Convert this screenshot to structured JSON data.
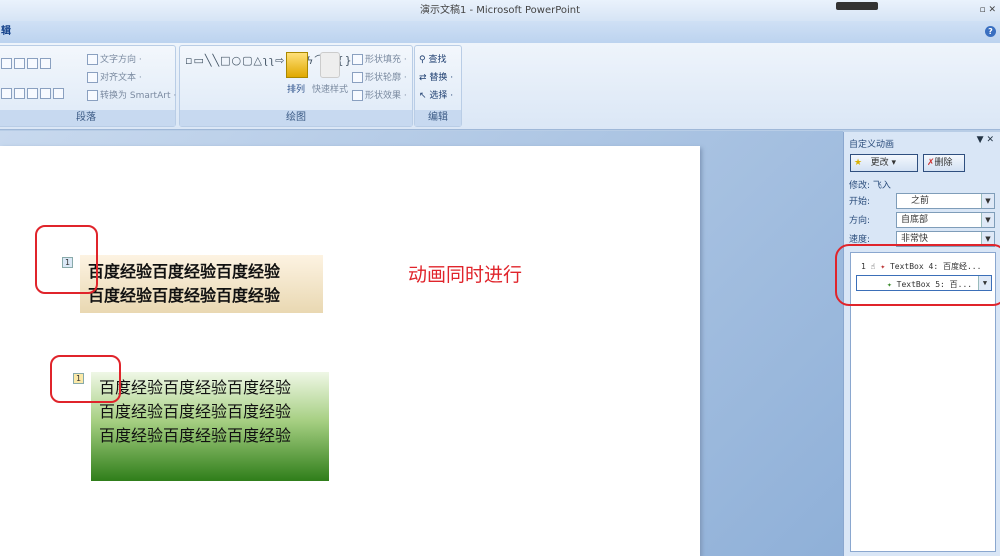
{
  "window": {
    "title": "演示文稿1 - Microsoft PowerPoint",
    "tab_fragment": "辑"
  },
  "ribbon": {
    "paragraph": {
      "label": "段落",
      "text_direction": "文字方向 ·",
      "align_text": "对齐文本 ·",
      "smartart": "转换为 SmartArt ·"
    },
    "drawing": {
      "label": "绘图",
      "arrange": "排列",
      "quick_styles": "快速样式",
      "shape_fill": "形状填充 ·",
      "shape_outline": "形状轮廓 ·",
      "shape_effects": "形状效果 ·",
      "shapes": "▫▭╲╲□○▢△ʅʅ⇨⇩◔ϟ⌒⌃{}"
    },
    "editing": {
      "label": "编辑",
      "find": "查找",
      "replace": "替换 ·",
      "select": "选择 ·"
    }
  },
  "slide": {
    "textbox1": {
      "badge": "1",
      "lines": [
        "百度经验百度经验百度经验",
        "百度经验百度经验百度经验"
      ]
    },
    "textbox2": {
      "badge": "1",
      "lines": [
        "百度经验百度经验百度经验",
        "百度经验百度经验百度经验",
        "百度经验百度经验百度经验"
      ]
    },
    "annotation": "动画同时进行"
  },
  "pane": {
    "title": "自定义动画",
    "change": "更改",
    "remove": "删除",
    "modify": "修改: 飞入",
    "start_label": "开始:",
    "start_value": "之前",
    "direction_label": "方向:",
    "direction_value": "自底部",
    "speed_label": "速度:",
    "speed_value": "非常快",
    "items": [
      {
        "num": "1",
        "name": "TextBox 4: 百度经..."
      },
      {
        "name": "TextBox 5: 百..."
      }
    ]
  }
}
